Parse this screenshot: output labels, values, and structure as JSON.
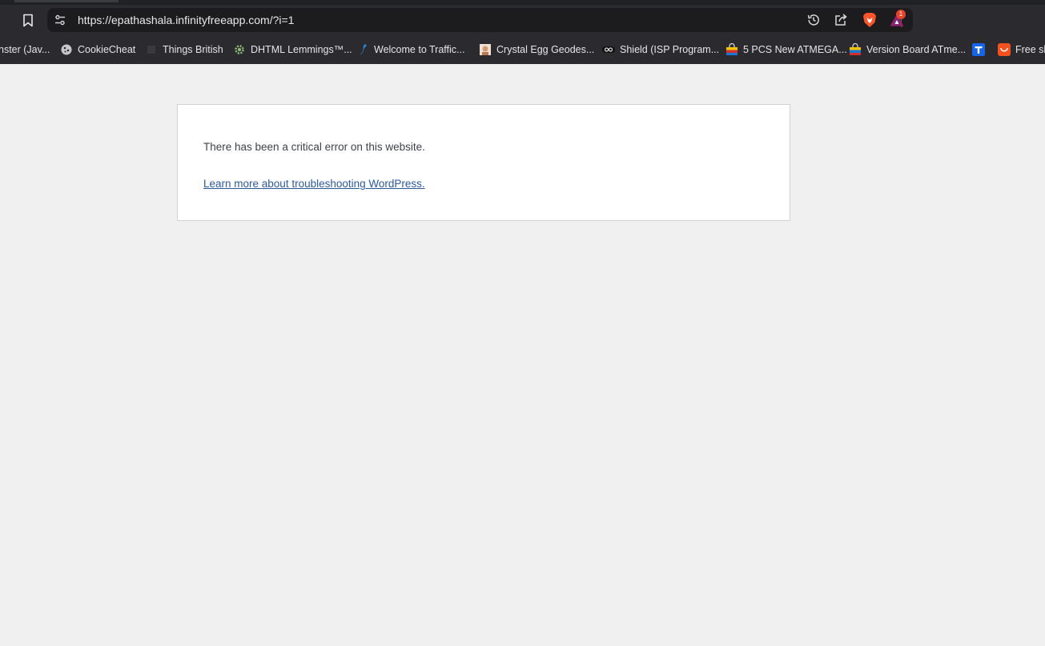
{
  "browser": {
    "url": "https://epathashala.infinityfreeapp.com/?i=1",
    "notification_count": "1"
  },
  "bookmarks": [
    {
      "label": "nster (Jav...",
      "icon": "none"
    },
    {
      "label": "CookieCheat",
      "icon": "cookie-icon"
    },
    {
      "label": "Things British",
      "icon": "blank-icon"
    },
    {
      "label": "DHTML Lemmings™...",
      "icon": "gear-icon"
    },
    {
      "label": "Welcome to Traffic...",
      "icon": "traffic-swoosh-icon"
    },
    {
      "label": "Crystal Egg Geodes...",
      "icon": "photo-icon"
    },
    {
      "label": "Shield (ISP Program...",
      "icon": "infinity-icon"
    },
    {
      "label": "5 PCS New ATMEGA...",
      "icon": "shop-bag-icon"
    },
    {
      "label": "Version Board ATme...",
      "icon": "shop-bag-icon"
    },
    {
      "label": "",
      "icon": "t-icon"
    },
    {
      "label": "Free sh",
      "icon": "shopping-tag-icon"
    }
  ],
  "error_page": {
    "message": "There has been a critical error on this website.",
    "link_text": "Learn more about troubleshooting WordPress."
  },
  "colors": {
    "page_bg": "#f0f0f0",
    "link": "#2c5aa0",
    "text": "#3c434a",
    "chrome_bg": "#2b2b2f"
  }
}
